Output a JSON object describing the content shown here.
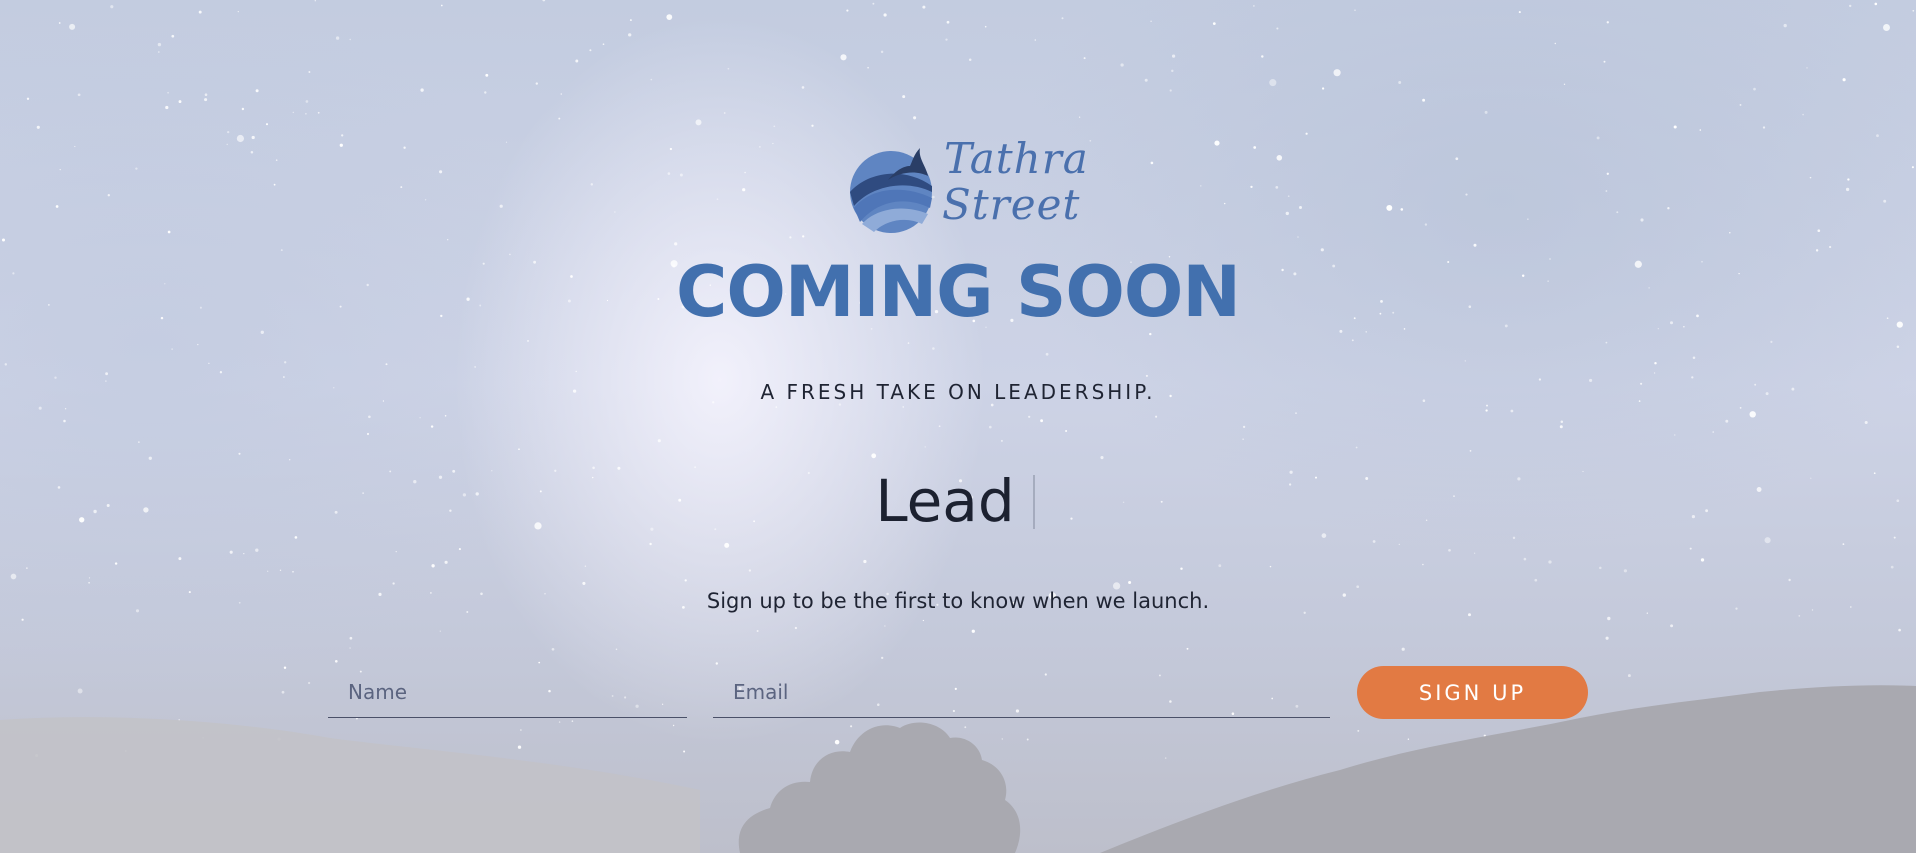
{
  "brand": {
    "logo_icon": "tathra-street-wave-logo",
    "name_line1": "Tathra",
    "name_line2": "Street",
    "color": "#4a70ad"
  },
  "hero": {
    "title": "COMING SOON",
    "tagline": "A FRESH TAKE ON LEADERSHIP.",
    "typed_word": "Lead",
    "signup_prompt": "Sign up to be the first to know when we launch."
  },
  "form": {
    "name_placeholder": "Name",
    "name_value": "",
    "email_placeholder": "Email",
    "email_value": "",
    "submit_label": "SIGN UP"
  },
  "colors": {
    "title": "#4270ae",
    "button": "#e27a43",
    "text": "#1f2433"
  }
}
